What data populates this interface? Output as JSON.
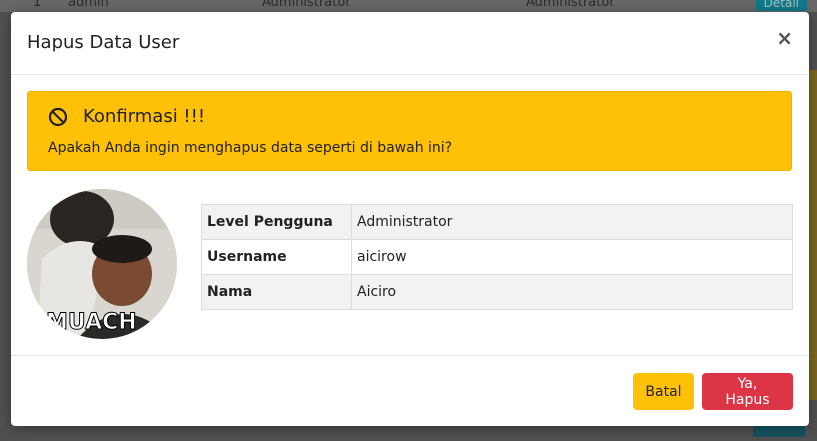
{
  "background": {
    "row_no": "1",
    "row_username": "admin",
    "row_level": "Administrator",
    "row_name": "Administrator",
    "detail_label": "Detail"
  },
  "modal": {
    "title": "Hapus Data User",
    "close_label": "×"
  },
  "alert": {
    "title": "Konfirmasi !!!",
    "message": "Apakah Anda ingin menghapus data seperti di bawah ini?",
    "icon": "ban-icon",
    "color": "#ffc107"
  },
  "avatar": {
    "caption": "EMUACH"
  },
  "details": [
    {
      "label": "Level Pengguna",
      "value": "Administrator"
    },
    {
      "label": "Username",
      "value": "aicirow"
    },
    {
      "label": "Nama",
      "value": "Aiciro"
    }
  ],
  "footer": {
    "cancel_label": "Batal",
    "confirm_label": "Ya, Hapus",
    "cancel_color": "#ffc107",
    "confirm_color": "#dc3545"
  }
}
